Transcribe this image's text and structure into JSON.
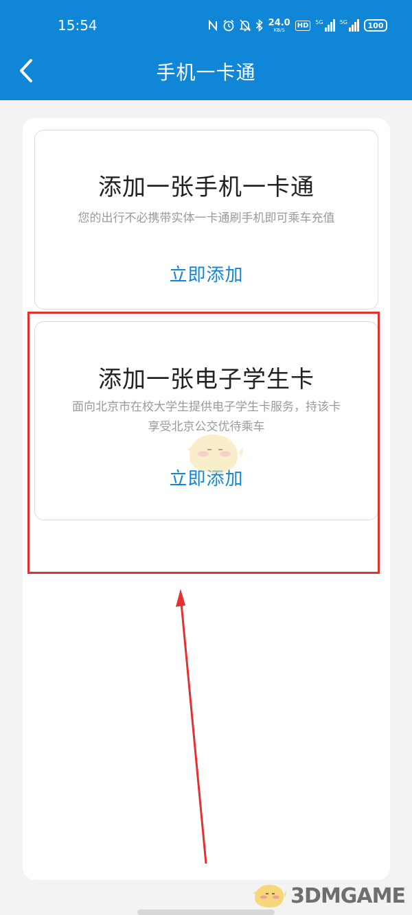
{
  "status_bar": {
    "time": "15:54",
    "network_speed": "24.0",
    "network_speed_unit": "KB/S",
    "hd_badge": "HD",
    "signal_1_label": "5G",
    "signal_2_label": "5G",
    "battery": "100",
    "icons": [
      "nfc-icon",
      "alarm-icon",
      "silent-bell-icon",
      "bluetooth-icon",
      "signal-icon",
      "battery-icon"
    ]
  },
  "nav": {
    "title": "手机一卡通",
    "back_icon": "chevron-left-icon"
  },
  "cards": [
    {
      "title": "添加一张手机一卡通",
      "description": "您的出行不必携带实体一卡通刷手机即可乘车充值",
      "action": "立即添加"
    },
    {
      "title": "添加一张电子学生卡",
      "description_line1": "面向北京市在校大学生提供电子学生卡服务，持该卡",
      "description_line2": "享受北京公交优待乘车",
      "action": "立即添加"
    }
  ],
  "annotation": {
    "highlight_color": "#e53030"
  },
  "colors": {
    "brand": "#0f86d6",
    "background": "#f3f3f3"
  },
  "watermark": {
    "text": "3DMGAME"
  }
}
